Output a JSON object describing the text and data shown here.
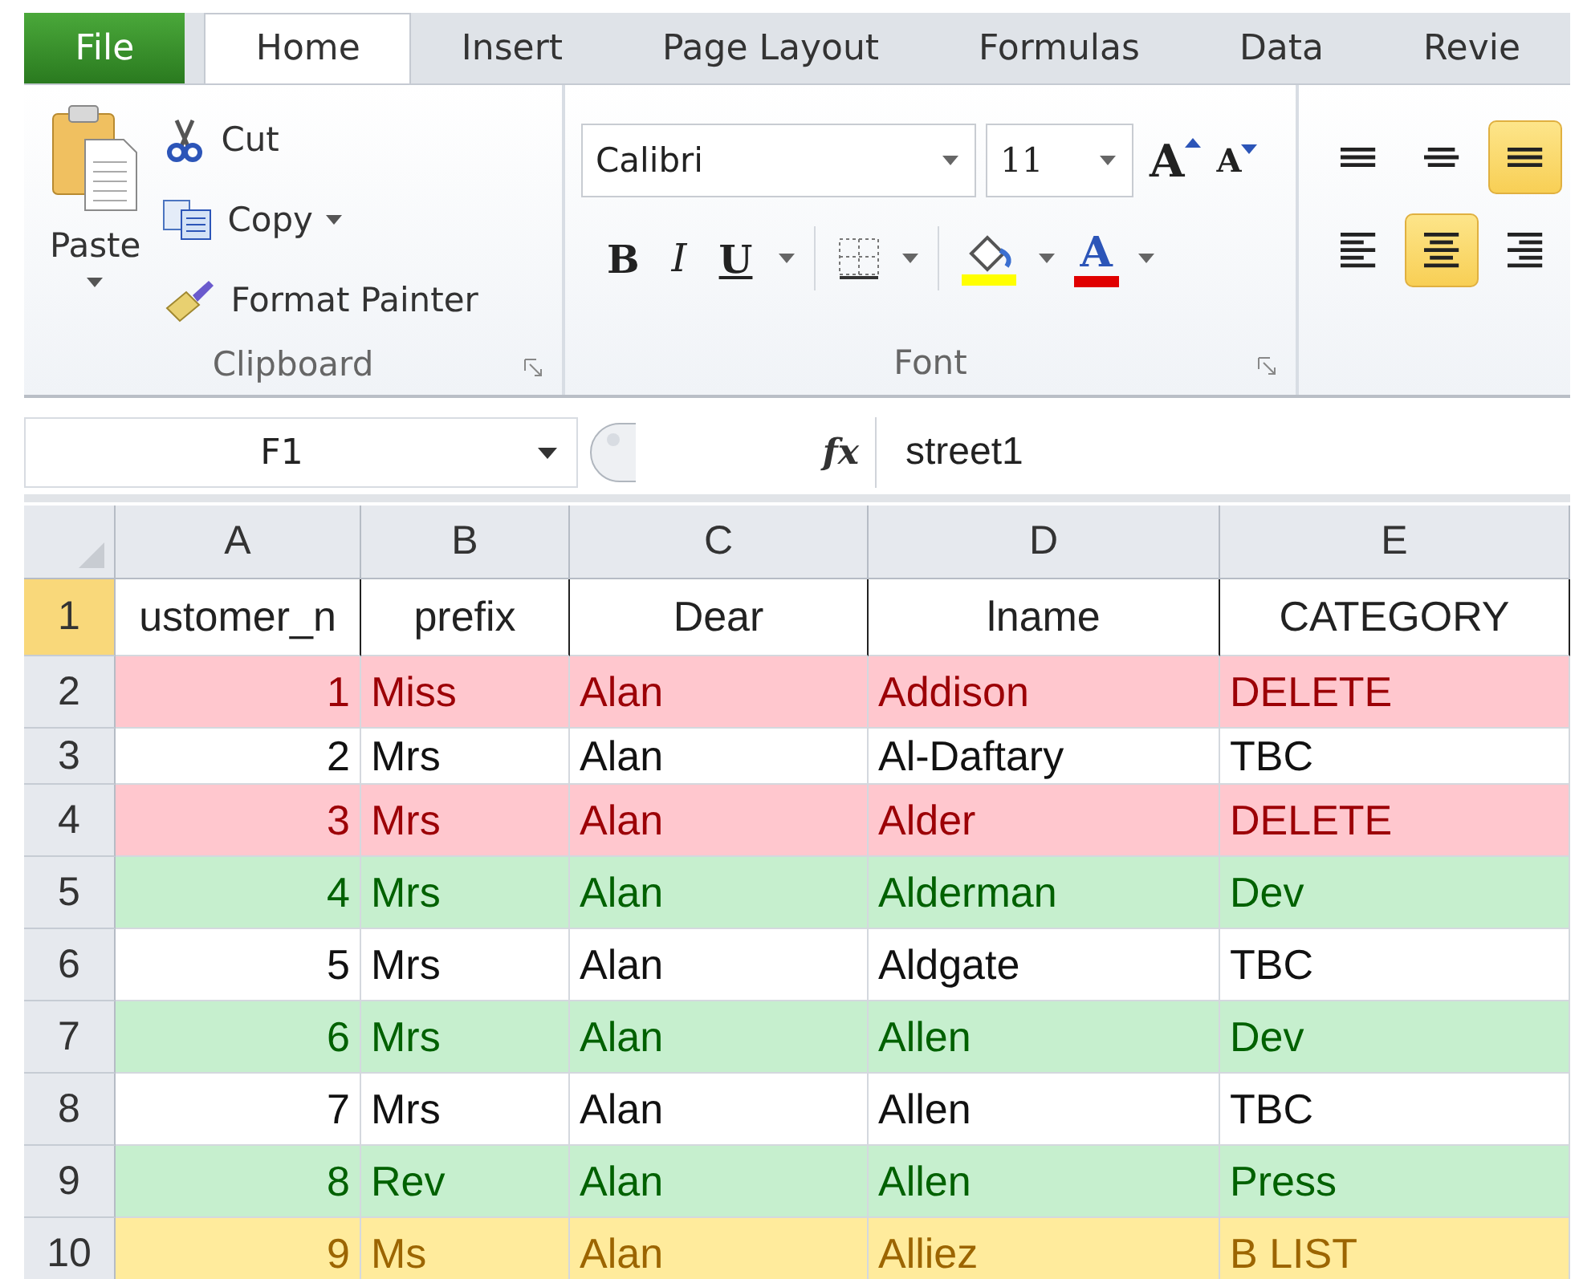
{
  "tabs": [
    {
      "label": "File",
      "kind": "file",
      "selected": false
    },
    {
      "label": "Home",
      "kind": "tab",
      "selected": true
    },
    {
      "label": "Insert",
      "kind": "tab",
      "selected": false
    },
    {
      "label": "Page Layout",
      "kind": "tab",
      "selected": false
    },
    {
      "label": "Formulas",
      "kind": "tab",
      "selected": false
    },
    {
      "label": "Data",
      "kind": "tab",
      "selected": false
    },
    {
      "label": "Revie",
      "kind": "tab",
      "selected": false
    }
  ],
  "clipboard": {
    "paste": "Paste",
    "items": [
      {
        "label": "Cut",
        "kind": "cut",
        "dropdown": false
      },
      {
        "label": "Copy",
        "kind": "copy",
        "dropdown": true
      },
      {
        "label": "Format Painter",
        "kind": "painter",
        "dropdown": false
      }
    ],
    "group_label": "Clipboard"
  },
  "font": {
    "name": "Calibri",
    "size": "11",
    "grow": "A",
    "shrink": "A",
    "styles": [
      {
        "label": "B",
        "kind": "bold"
      },
      {
        "label": "I",
        "kind": "italic"
      },
      {
        "label": "U",
        "kind": "underline"
      }
    ],
    "font_color": "A",
    "group_label": "Font"
  },
  "alignment": {
    "vertical": [
      {
        "kind": "top",
        "selected": false
      },
      {
        "kind": "middle",
        "selected": false
      },
      {
        "kind": "bottom",
        "selected": true
      }
    ],
    "horizontal": [
      {
        "kind": "left",
        "selected": false
      },
      {
        "kind": "center",
        "selected": true
      },
      {
        "kind": "right",
        "selected": false
      }
    ]
  },
  "formula_bar": {
    "name_box": "F1",
    "fx": "fx",
    "formula": "street1"
  },
  "sheet": {
    "columns": [
      {
        "label": "A",
        "kind": "number"
      },
      {
        "label": "B",
        "kind": "text"
      },
      {
        "label": "C",
        "kind": "text"
      },
      {
        "label": "D",
        "kind": "text"
      },
      {
        "label": "E",
        "kind": "text"
      }
    ],
    "rows": [
      {
        "number": "1",
        "selected": true,
        "kind": "header",
        "cells": [
          "ustomer_n",
          "prefix",
          "Dear",
          "lname",
          "CATEGORY"
        ]
      },
      {
        "number": "2",
        "selected": false,
        "kind": "bad",
        "cells": [
          "1",
          "Miss",
          "Alan",
          "Addison",
          "DELETE"
        ]
      },
      {
        "number": "3",
        "selected": false,
        "kind": "plain",
        "cells": [
          "2",
          "Mrs",
          "Alan",
          "Al-Daftary",
          "TBC"
        ]
      },
      {
        "number": "4",
        "selected": false,
        "kind": "bad",
        "cells": [
          "3",
          "Mrs",
          "Alan",
          "Alder",
          "DELETE"
        ]
      },
      {
        "number": "5",
        "selected": false,
        "kind": "good",
        "cells": [
          "4",
          "Mrs",
          "Alan",
          "Alderman",
          "Dev"
        ]
      },
      {
        "number": "6",
        "selected": false,
        "kind": "plain",
        "cells": [
          "5",
          "Mrs",
          "Alan",
          "Aldgate",
          "TBC"
        ]
      },
      {
        "number": "7",
        "selected": false,
        "kind": "good",
        "cells": [
          "6",
          "Mrs",
          "Alan",
          "Allen",
          "Dev"
        ]
      },
      {
        "number": "8",
        "selected": false,
        "kind": "plain",
        "cells": [
          "7",
          "Mrs",
          "Alan",
          "Allen",
          "TBC"
        ]
      },
      {
        "number": "9",
        "selected": false,
        "kind": "good",
        "cells": [
          "8",
          "Rev",
          "Alan",
          "Allen",
          "Press"
        ]
      },
      {
        "number": "10",
        "selected": false,
        "kind": "neutral",
        "cells": [
          "9",
          "Ms",
          "Alan",
          "Alliez",
          "B LIST"
        ]
      }
    ]
  }
}
